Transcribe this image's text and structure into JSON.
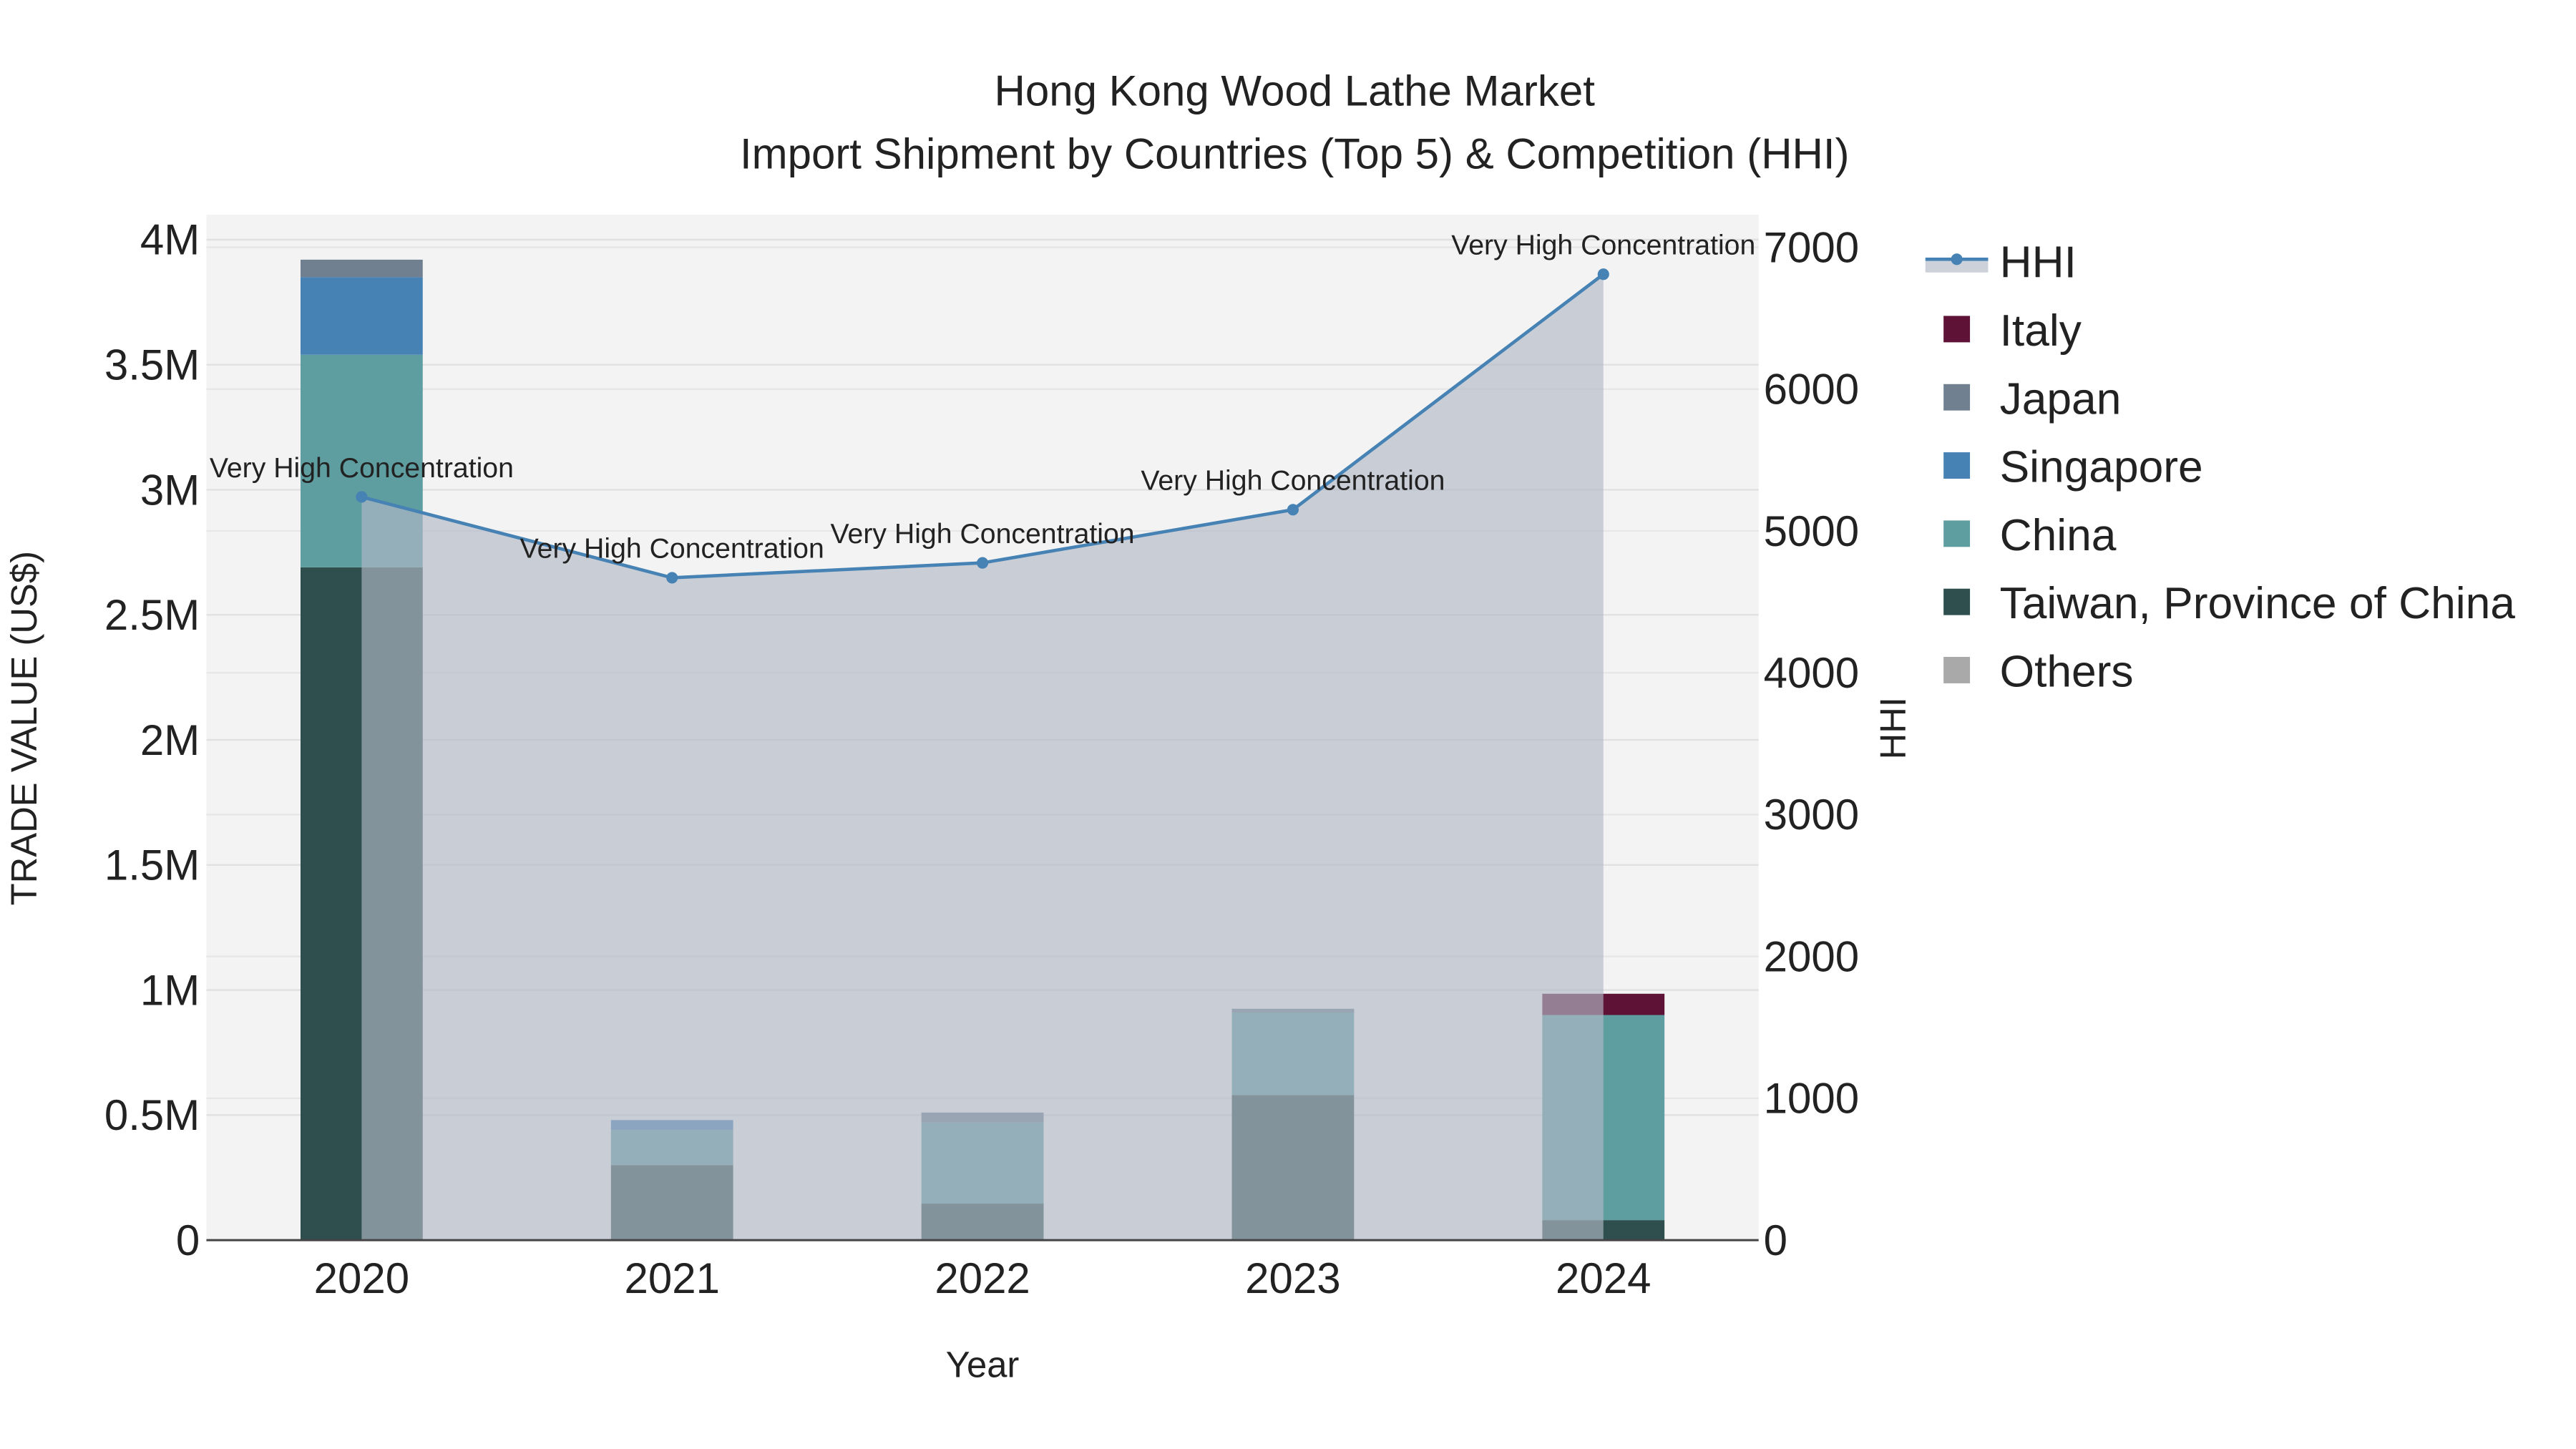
{
  "chart_data": {
    "type": "bar",
    "title": "Hong Kong Wood Lathe Market",
    "subtitle": "Import Shipment by Countries (Top 5) & Competition (HHI)",
    "xlabel": "Year",
    "ylabel": "TRADE VALUE (US$)",
    "y2label": "HHI",
    "categories": [
      "2020",
      "2021",
      "2022",
      "2023",
      "2024"
    ],
    "ylim": [
      0,
      4100000
    ],
    "y2lim": [
      0,
      7230
    ],
    "yticks": [
      0,
      500000,
      1000000,
      1500000,
      2000000,
      2500000,
      3000000,
      3500000,
      4000000
    ],
    "ytick_labels": [
      "0",
      "0.5M",
      "1M",
      "1.5M",
      "2M",
      "2.5M",
      "3M",
      "3.5M",
      "4M"
    ],
    "y2ticks": [
      0,
      1000,
      2000,
      3000,
      4000,
      5000,
      6000,
      7000
    ],
    "y2tick_labels": [
      "0",
      "1000",
      "2000",
      "3000",
      "4000",
      "5000",
      "6000",
      "7000"
    ],
    "stacked": true,
    "grid": true,
    "legend_position": "right",
    "series": [
      {
        "name": "Taiwan, Province of China",
        "color": "#2F4F4F",
        "values": [
          2690000,
          300000,
          146000,
          580000,
          80000
        ]
      },
      {
        "name": "China",
        "color": "#5F9EA0",
        "values": [
          850000,
          140000,
          324000,
          330000,
          820000
        ]
      },
      {
        "name": "Singapore",
        "color": "#4682B4",
        "values": [
          310000,
          40000,
          0,
          0,
          0
        ]
      },
      {
        "name": "Japan",
        "color": "#708090",
        "values": [
          70000,
          0,
          40000,
          15000,
          0
        ]
      },
      {
        "name": "Italy",
        "color": "#5E1236",
        "values": [
          0,
          0,
          0,
          0,
          85000
        ]
      },
      {
        "name": "Others",
        "color": "#A9A9A9",
        "values": [
          0,
          0,
          0,
          0,
          0
        ]
      }
    ],
    "hhi": {
      "name": "HHI",
      "color": "#4682B4",
      "values": [
        5240,
        4670,
        4775,
        5150,
        6810
      ],
      "annotations": [
        "Very High Concentration",
        "Very High Concentration",
        "Very High Concentration",
        "Very High Concentration",
        "Very High Concentration"
      ]
    },
    "legend": [
      "HHI",
      "Italy",
      "Japan",
      "Singapore",
      "China",
      "Taiwan, Province of China",
      "Others"
    ]
  }
}
